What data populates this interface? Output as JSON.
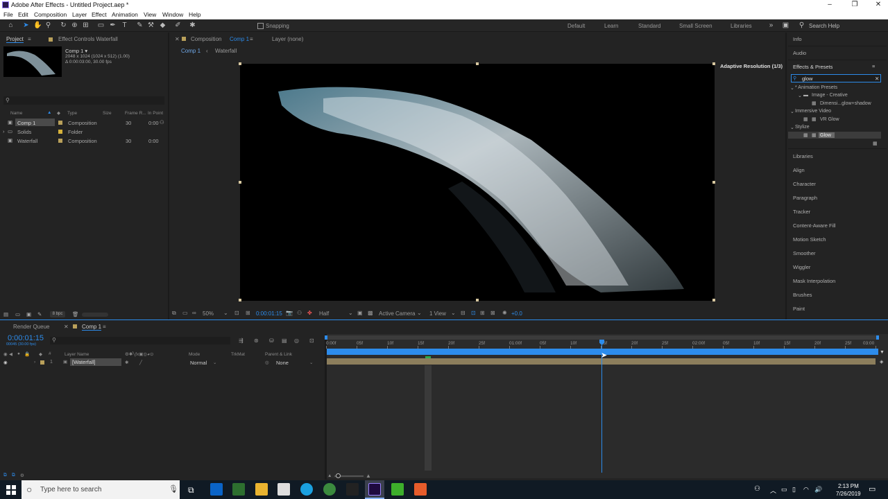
{
  "title_bar": {
    "title": "Adobe After Effects - Untitled Project.aep *"
  },
  "menu": [
    "File",
    "Edit",
    "Composition",
    "Layer",
    "Effect",
    "Animation",
    "View",
    "Window",
    "Help"
  ],
  "toolbar": {
    "snapping_label": "Snapping",
    "workspaces": [
      "Default",
      "Learn",
      "Standard",
      "Small Screen",
      "Libraries"
    ],
    "search_help_placeholder": "Search Help"
  },
  "project_panel": {
    "tab_project": "Project",
    "tab_effect_controls": "Effect Controls Waterfall",
    "comp_name": "Comp 1 ▾",
    "comp_info_1": "2048 x 1024  (1024 x 512) (1.00)",
    "comp_info_2": "Δ 0:00:03:00, 30.00 fps",
    "columns": {
      "name": "Name",
      "type": "Type",
      "size": "Size",
      "frame_rate": "Frame R...",
      "in_point": "In Point"
    },
    "items": [
      {
        "name": "Comp 1",
        "type": "Composition",
        "fps": "30",
        "in": "0:00"
      },
      {
        "name": "Solids",
        "type": "Folder",
        "fps": "",
        "in": ""
      },
      {
        "name": "Waterfall",
        "type": "Composition",
        "fps": "30",
        "in": "0:00"
      }
    ],
    "bpc": "8 bpc"
  },
  "comp_panel": {
    "tab_label_prefix": "Composition",
    "tab_label_name": "Comp 1",
    "layer_tab": "Layer (none)",
    "breadcrumb": [
      "Comp 1",
      "Waterfall"
    ],
    "adaptive_resolution": "Adaptive Resolution (1/3)",
    "footer": {
      "zoom": "50%",
      "timecode": "0:00:01:15",
      "resolution": "Half",
      "camera": "Active Camera",
      "view": "1 View",
      "exposure": "+0.0"
    }
  },
  "right_panel": {
    "info": "Info",
    "audio": "Audio",
    "effects_presets": "Effects & Presets",
    "search_value": "glow",
    "tree": [
      {
        "label": "* Animation Presets"
      },
      {
        "label": "Image - Creative"
      },
      {
        "label": "Dimensi...glow+shadow"
      },
      {
        "label": "Immersive Video"
      },
      {
        "label": "VR Glow"
      },
      {
        "label": "Stylize"
      },
      {
        "label": "Glow"
      }
    ],
    "panels": [
      "Libraries",
      "Align",
      "Character",
      "Paragraph",
      "Tracker",
      "Content-Aware Fill",
      "Motion Sketch",
      "Smoother",
      "Wiggler",
      "Mask Interpolation",
      "Brushes",
      "Paint"
    ]
  },
  "timeline": {
    "tab_render_queue": "Render Queue",
    "tab_comp": "Comp 1",
    "current_time": "0:00:01:15",
    "frame_info": "00045 (30.00 fps)",
    "columns": {
      "layer_name": "Layer Name",
      "mode": "Mode",
      "trkmat": "TrkMat",
      "parent": "Parent & Link"
    },
    "layer": {
      "index": "1",
      "name": "[Waterfall]",
      "mode": "Normal",
      "parent": "None"
    },
    "ruler": [
      "0:00f",
      "05f",
      "10f",
      "15f",
      "20f",
      "25f",
      "01:00f",
      "05f",
      "10f",
      "15f",
      "20f",
      "25f",
      "02:00f",
      "05f",
      "10f",
      "15f",
      "20f",
      "25f",
      "03:00"
    ],
    "playhead_fraction": 0.5
  },
  "taskbar": {
    "search_placeholder": "Type here to search",
    "time": "2:13 PM",
    "date": "7/26/2019"
  },
  "colors": {
    "accent_blue": "#2d8ceb",
    "label_tan": "#b9a05a",
    "label_yellow": "#d6b23a"
  }
}
